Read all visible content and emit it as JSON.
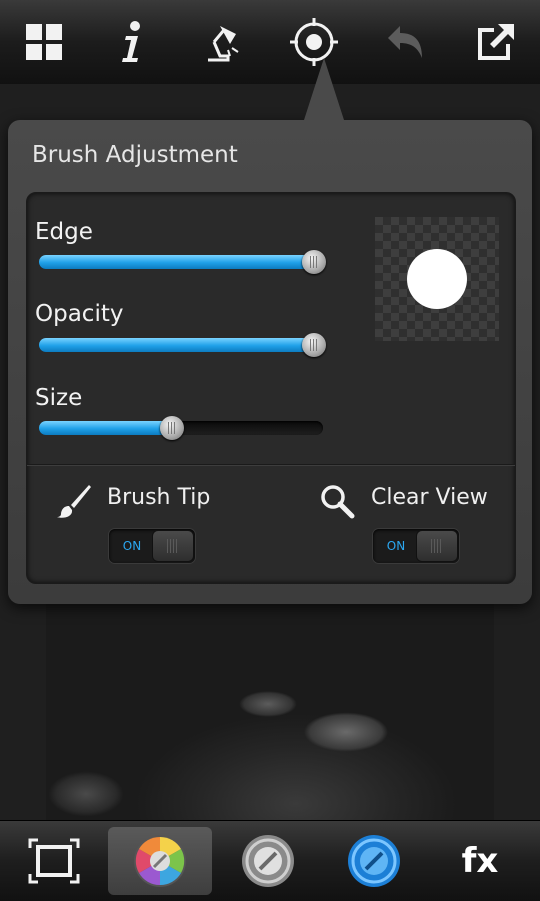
{
  "toolbar": {
    "icons": [
      "grid-icon",
      "info-icon",
      "lamp-icon",
      "target-icon",
      "undo-icon",
      "export-icon"
    ]
  },
  "brush_panel": {
    "title": "Brush Adjustment",
    "sliders": [
      {
        "label": "Edge",
        "value_percent": 97
      },
      {
        "label": "Opacity",
        "value_percent": 97
      },
      {
        "label": "Size",
        "value_percent": 47
      }
    ],
    "brush_tip": {
      "label": "Brush Tip",
      "toggle_text": "ON"
    },
    "clear_view": {
      "label": "Clear View",
      "toggle_text": "ON"
    }
  },
  "bottom_bar": {
    "fx_label": "fx",
    "icons": [
      "crop-icon",
      "color-wheel-icon",
      "gray-brush-icon",
      "blue-brush-icon",
      "fx-icon"
    ]
  },
  "colors": {
    "accent": "#1fa0e8",
    "panel_bg": "#2a2a2a",
    "popup_bg": "#444444"
  }
}
